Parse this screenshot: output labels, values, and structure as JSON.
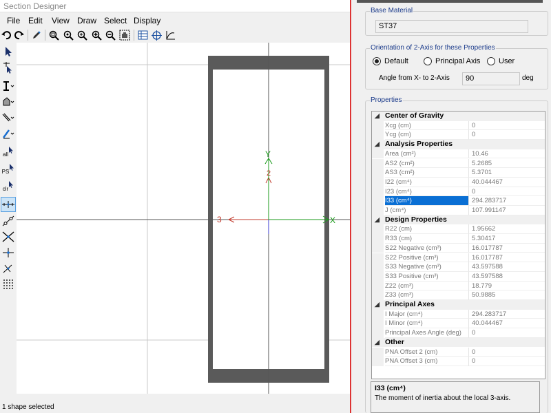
{
  "window": {
    "title": "Section Designer"
  },
  "menu": [
    "File",
    "Edit",
    "View",
    "Draw",
    "Select",
    "Display"
  ],
  "toolbar_icons": [
    "undo-icon",
    "redo-icon",
    "pencil-icon",
    "zoom-window-icon",
    "zoom-restore-icon",
    "zoom-in-icon",
    "zoom-in-step-icon",
    "zoom-out-icon",
    "pan-icon",
    "grid-table-icon",
    "crosshair-icon",
    "curve-icon"
  ],
  "side_tools": {
    "labels": {
      "all": "all",
      "ps": "PS",
      "clr": "clr"
    }
  },
  "canvas": {
    "axis_x_label": "X",
    "axis_y_label": "Y",
    "axis_3_label": "3",
    "axis_2_label": "2",
    "colors": {
      "x_axis": "#1a9a1a",
      "local_axis": "#c0392b",
      "section_fill": "#5a5a5a"
    }
  },
  "status": {
    "text": "1 shape selected"
  },
  "base_material": {
    "title": "Base Material",
    "value": "ST37"
  },
  "orientation": {
    "title": "Orientation of 2-Axis for these Properties",
    "options": [
      "Default",
      "Principal Axis",
      "User"
    ],
    "selected": "Default",
    "angle_label": "Angle from X-  to 2-Axis",
    "angle_value": "90",
    "angle_unit": "deg"
  },
  "properties": {
    "title": "Properties",
    "categories": [
      {
        "name": "Center of Gravity",
        "rows": [
          {
            "name": "Xcg (cm)",
            "value": "0"
          },
          {
            "name": "Ycg (cm)",
            "value": "0"
          }
        ]
      },
      {
        "name": "Analysis Properties",
        "rows": [
          {
            "name": "Area (cm²)",
            "value": "10.46"
          },
          {
            "name": "AS2 (cm²)",
            "value": "5.2685"
          },
          {
            "name": "AS3 (cm²)",
            "value": "5.3701"
          },
          {
            "name": "I22 (cm⁴)",
            "value": "40.044467"
          },
          {
            "name": "I23 (cm⁴)",
            "value": "0"
          },
          {
            "name": "I33 (cm⁴)",
            "value": "294.283717",
            "selected": true
          },
          {
            "name": "J (cm⁴)",
            "value": "107.991147"
          }
        ]
      },
      {
        "name": "Design Properties",
        "rows": [
          {
            "name": "R22 (cm)",
            "value": "1.95662"
          },
          {
            "name": "R33 (cm)",
            "value": "5.30417"
          },
          {
            "name": "S22 Negative (cm³)",
            "value": "16.017787"
          },
          {
            "name": "S22 Positive (cm³)",
            "value": "16.017787"
          },
          {
            "name": "S33 Negative (cm³)",
            "value": "43.597588"
          },
          {
            "name": "S33 Positive (cm³)",
            "value": "43.597588"
          },
          {
            "name": "Z22 (cm³)",
            "value": "18.779"
          },
          {
            "name": "Z33 (cm³)",
            "value": "50.9885"
          }
        ]
      },
      {
        "name": "Principal Axes",
        "rows": [
          {
            "name": "I Major (cm⁴)",
            "value": "294.283717"
          },
          {
            "name": "I Minor (cm⁴)",
            "value": "40.044467"
          },
          {
            "name": "Principal Axes Angle (deg)",
            "value": "0"
          }
        ]
      },
      {
        "name": "Other",
        "rows": [
          {
            "name": "PNA Offset 2 (cm)",
            "value": "0"
          },
          {
            "name": "PNA Offset 3 (cm)",
            "value": "0"
          }
        ]
      }
    ]
  },
  "description": {
    "title": "I33 (cm⁴)",
    "text": "The moment of inertia about the local 3-axis."
  }
}
